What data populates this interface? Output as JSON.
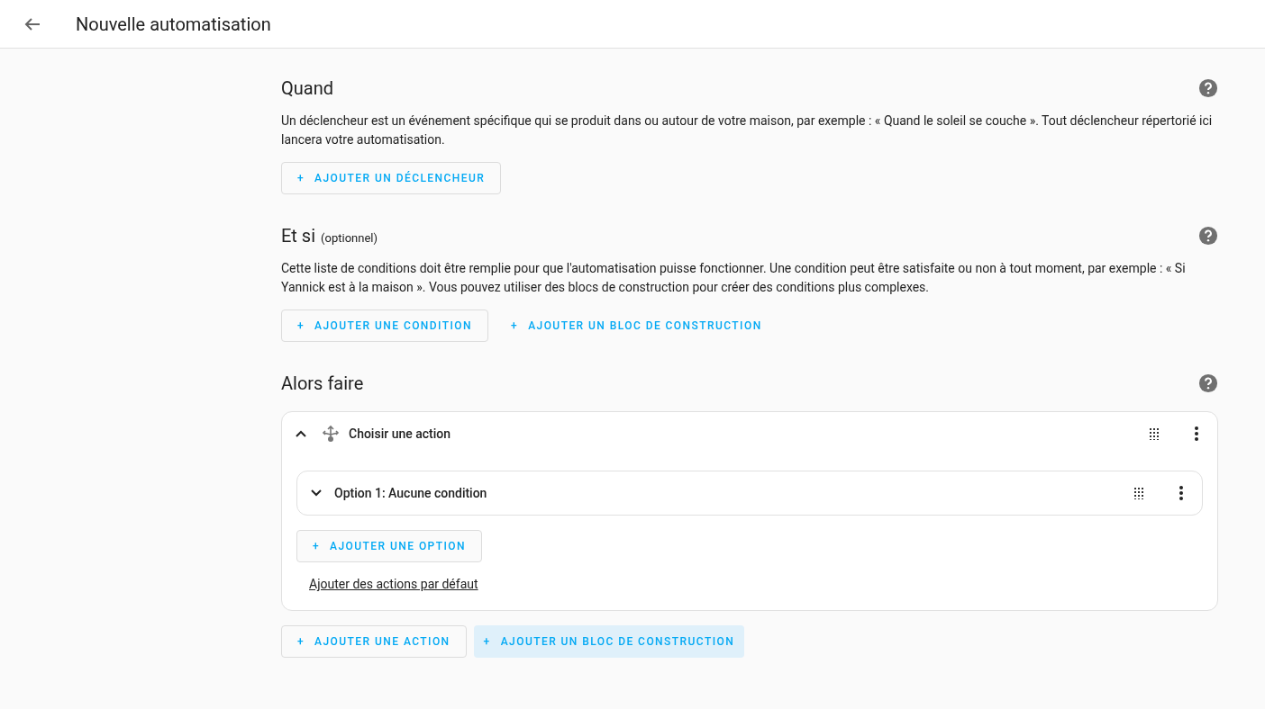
{
  "header": {
    "title": "Nouvelle automatisation"
  },
  "sections": [
    {
      "title": "Quand",
      "description": "Un déclencheur est un événement spécifique qui se produit dans ou autour de votre maison, par exemple : « Quand le soleil se couche ». Tout déclencheur répertorié ici lancera votre automatisation.",
      "buttons": [
        {
          "kind": "outlined",
          "icon": "+",
          "label": "AJOUTER UN DÉCLENCHEUR"
        }
      ]
    },
    {
      "title": "Et si",
      "suffix": "(optionnel)",
      "description": "Cette liste de conditions doit être remplie pour que l'automatisation puisse fonctionner. Une condition peut être satisfaite ou non à tout moment, par exemple : « Si Yannick est à la maison ». Vous pouvez utiliser des blocs de construction pour créer des conditions plus complexes.",
      "buttons": [
        {
          "kind": "outlined",
          "icon": "+",
          "label": "AJOUTER UNE CONDITION"
        },
        {
          "kind": "text",
          "icon": "+",
          "label": "AJOUTER UN BLOC DE CONSTRUCTION"
        }
      ]
    },
    {
      "title": "Alors faire",
      "action": {
        "title": "Choisir une action",
        "expanded": true,
        "options": [
          {
            "title": "Option 1: Aucune condition",
            "expanded": false
          }
        ],
        "add_option": {
          "icon": "+",
          "label": "AJOUTER UNE OPTION"
        },
        "default_link": "Ajouter des actions par défaut"
      },
      "buttons": [
        {
          "kind": "outlined",
          "icon": "+",
          "label": "AJOUTER UNE ACTION"
        },
        {
          "kind": "tonal",
          "icon": "+",
          "label": "AJOUTER UN BLOC DE CONSTRUCTION"
        }
      ]
    }
  ]
}
